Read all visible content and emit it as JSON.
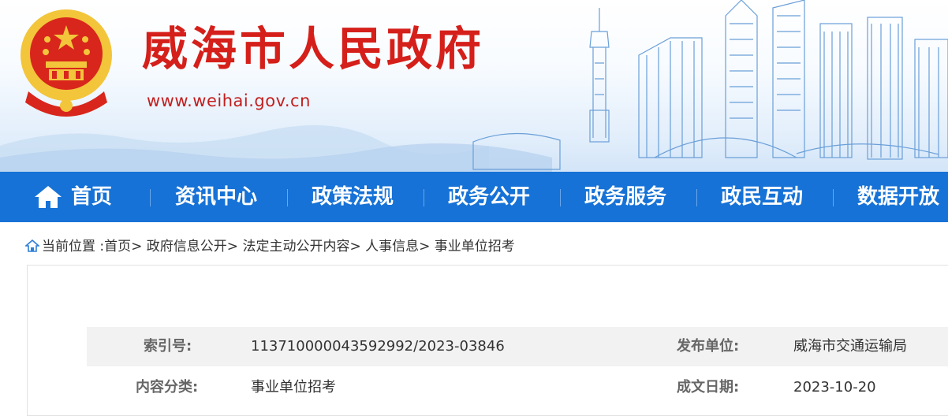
{
  "header": {
    "site_title": "威海市人民政府",
    "site_url": "www.weihai.gov.cn",
    "colors": {
      "title": "#d51f1a",
      "nav_bg": "#1672d6",
      "emblem_red": "#d8261c",
      "emblem_gold": "#f3c53b"
    }
  },
  "nav": {
    "items": [
      {
        "label": "首页",
        "icon": "home-icon"
      },
      {
        "label": "资讯中心"
      },
      {
        "label": "政策法规"
      },
      {
        "label": "政务公开"
      },
      {
        "label": "政务服务"
      },
      {
        "label": "政民互动"
      },
      {
        "label": "数据开放"
      }
    ]
  },
  "breadcrumb": {
    "icon": "location-house-icon",
    "prefix": "当前位置 :",
    "items": [
      "首页",
      "政府信息公开",
      "法定主动公开内容",
      "人事信息",
      "事业单位招考"
    ],
    "separator": ">"
  },
  "info_table": {
    "rows": [
      {
        "label_left": "索引号:",
        "value_left": "11371000004359299​2/2023-03846",
        "label_right": "发布单位:",
        "value_right": "威海市交通运输局"
      },
      {
        "label_left": "内容分类:",
        "value_left": "事业单位招考",
        "label_right": "成文日期:",
        "value_right": "2023-10-20"
      }
    ]
  }
}
